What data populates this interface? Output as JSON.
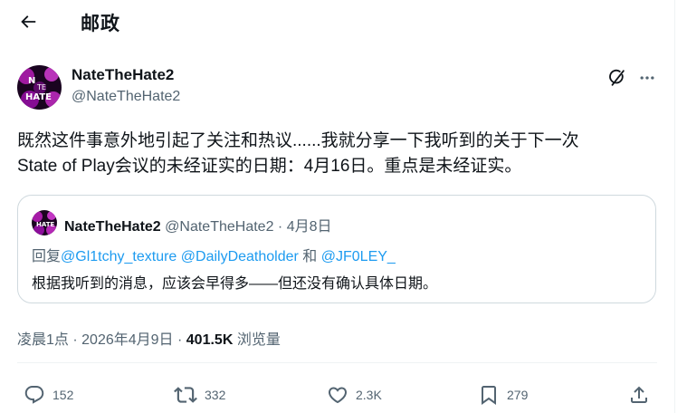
{
  "header": {
    "title": "邮政"
  },
  "tweet": {
    "author": {
      "display_name": "NateTheHate2",
      "handle": "@NateTheHate2"
    },
    "text_line1": "既然这件事意外地引起了关注和热议......我就分享一下我听到的关于下一次",
    "text_line2": "State of Play会议的未经证实的日期：4月16日。重点是未经证实。",
    "quoted": {
      "display_name": "NateTheHate2",
      "handle": "@NateTheHate2",
      "separator": "·",
      "date": "4月8日",
      "reply_prefix": "回复",
      "mentions": [
        "@Gl1tchy_texture",
        "@DailyDeatholder",
        "@JF0LEY_"
      ],
      "and_word": "和",
      "text": "根据我听到的消息，应该会早得多——但还没有确认具体日期。"
    },
    "time": "凌晨1点",
    "separator": "·",
    "date": "2026年4月9日",
    "views_count": "401.5K",
    "views_label": "浏览量",
    "stats": {
      "replies": "152",
      "reposts": "332",
      "likes": "2.3K",
      "bookmarks": "279"
    }
  },
  "icons": {
    "back": "arrow-left-icon",
    "grok": "grok-icon",
    "more": "more-dots-icon",
    "reply": "reply-bubble-icon",
    "repost": "repost-icon",
    "like": "heart-icon",
    "bookmark": "bookmark-icon",
    "share": "share-icon"
  },
  "colors": {
    "text": "#0f1419",
    "secondary": "#536471",
    "link": "#1d9bf0",
    "border": "#cfd9de",
    "avatar_accent": "#e040e0"
  }
}
